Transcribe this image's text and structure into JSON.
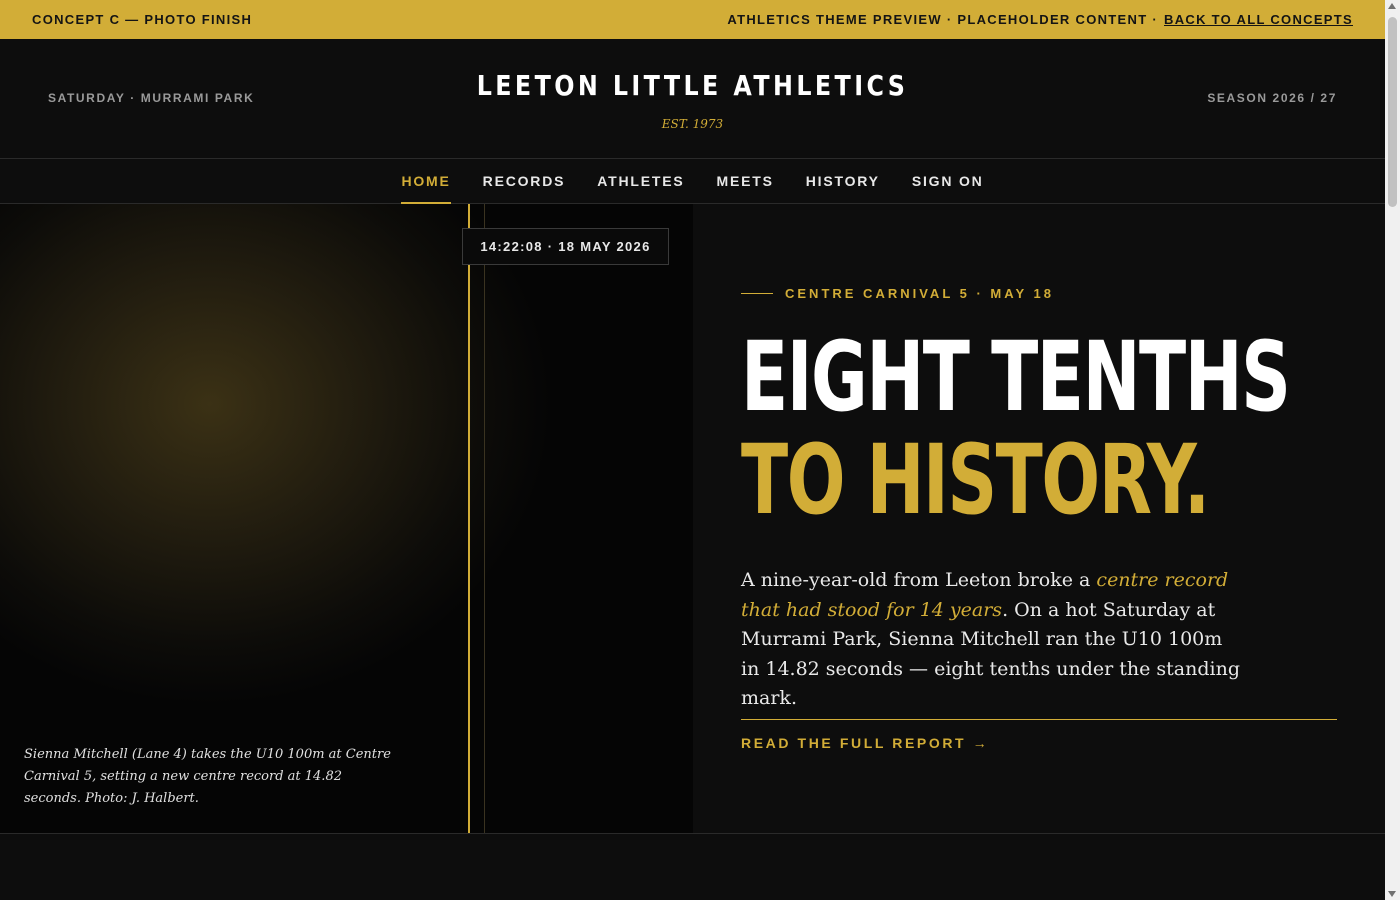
{
  "topbar": {
    "concept": "CONCEPT C — PHOTO FINISH",
    "preview": "ATHLETICS THEME PREVIEW · PLACEHOLDER CONTENT ·",
    "back_link": "BACK TO ALL CONCEPTS"
  },
  "header": {
    "left_meta": "SATURDAY · MURRAMI PARK",
    "title": "LEETON LITTLE ATHLETICS",
    "established": "EST. 1973",
    "right_meta": "SEASON 2026 / 27"
  },
  "nav": {
    "items": [
      {
        "label": "HOME",
        "active": true
      },
      {
        "label": "RECORDS",
        "active": false
      },
      {
        "label": "ATHLETES",
        "active": false
      },
      {
        "label": "MEETS",
        "active": false
      },
      {
        "label": "HISTORY",
        "active": false
      },
      {
        "label": "SIGN ON",
        "active": false
      }
    ]
  },
  "photo": {
    "timestamp": "14:22:08 · 18 MAY 2026",
    "caption": "Sienna Mitchell (Lane 4) takes the U10 100m at Centre Carnival 5, setting a new centre record at 14.82 seconds. Photo: J. Halbert."
  },
  "story": {
    "kicker": "CENTRE CARNIVAL 5 · MAY 18",
    "headline_line1": "EIGHT TENTHS",
    "headline_line2": "TO HISTORY.",
    "lede_before": "A nine-year-old from Leeton broke a ",
    "lede_emphasis": "centre record that had stood for 14 years",
    "lede_after": ". On a hot Saturday at Murrami Park, Sienna Mitchell ran the U10 100m in 14.82 seconds — eight tenths under the standing mark.",
    "read_more": "READ THE FULL REPORT →"
  },
  "colors": {
    "accent": "#d2ad37",
    "background": "#0d0d0d",
    "text": "#ffffff"
  }
}
